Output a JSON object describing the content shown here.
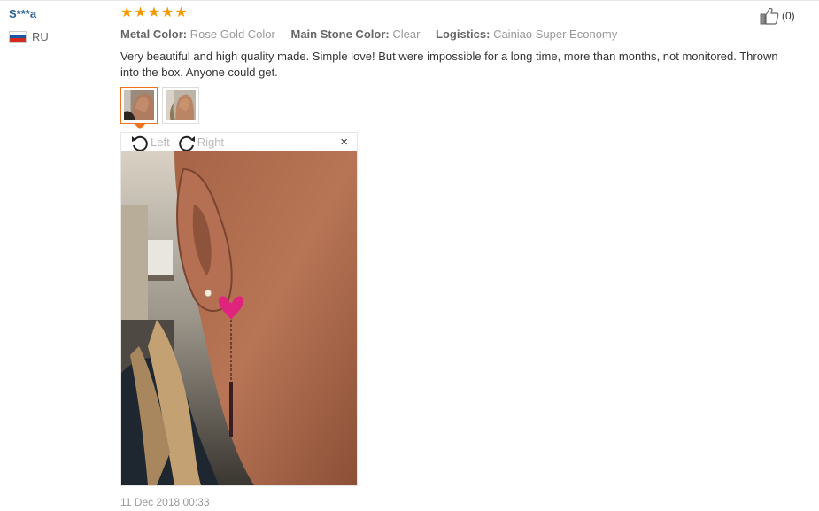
{
  "review": {
    "user_name": "S***a",
    "country_code": "RU",
    "rating_stars": 5,
    "attributes": [
      {
        "label": "Metal Color:",
        "value": "Rose Gold Color"
      },
      {
        "label": "Main Stone Color:",
        "value": "Clear"
      },
      {
        "label": "Logistics:",
        "value": "Cainiao Super Economy"
      }
    ],
    "text": "Very beautiful and high quality made. Simple love! But were impossible for a long time, more than months, not monitored. Thrown into the box. Anyone could get.",
    "like_count": "(0)",
    "timestamp": "11 Dec 2018 00:33"
  },
  "viewer": {
    "rotate_left_label": "Left",
    "rotate_right_label": "Right",
    "close_symbol": "×"
  },
  "colors": {
    "star": "#f59b00",
    "username": "#2a6496",
    "active_thumb_border": "#f2711c"
  },
  "icons": {
    "star": "star-icon",
    "flag": "russia-flag-icon",
    "like": "thumbs-up-icon",
    "rotate_left": "rotate-left-icon",
    "rotate_right": "rotate-right-icon",
    "close": "close-icon"
  }
}
